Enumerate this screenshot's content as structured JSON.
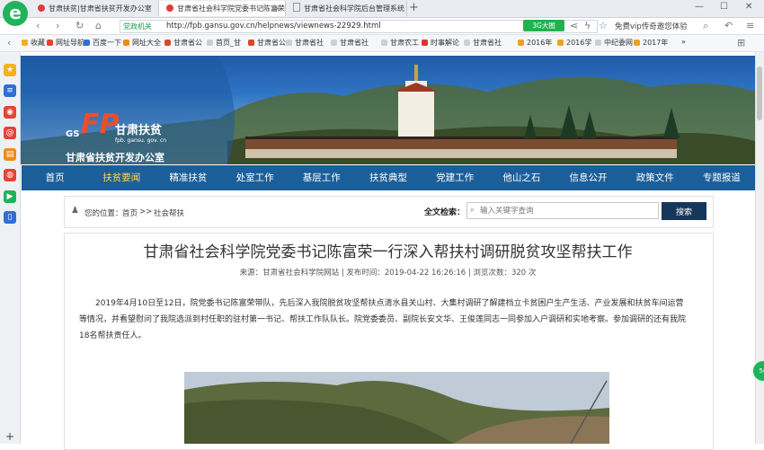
{
  "browser": {
    "logo_letter": "e",
    "tabs": [
      {
        "title": "甘肃扶贫|甘肃省扶贫开发办公室",
        "active": false
      },
      {
        "title": "甘肃省社会科学院党委书记陈富荣",
        "active": true
      },
      {
        "title": "甘肃省社会科学院后台管理系统",
        "active": false
      }
    ],
    "new_tab": "+",
    "win_controls": {
      "min": "—",
      "max": "☐",
      "close": "✕"
    },
    "address": {
      "secure_label": "党政机关",
      "url": "http://fpb.gansu.gov.cn/helpnews/viewnews-22929.html",
      "speed_label": "3G大图",
      "promo": "免费vip传奇邀您体验"
    },
    "bookmarks": [
      {
        "label": "收藏",
        "color": "#f2b01e"
      },
      {
        "label": "网址导航",
        "color": "#e54335"
      },
      {
        "label": "百度一下",
        "color": "#2f6fd6"
      },
      {
        "label": "网址大全",
        "color": "#f08a1c"
      },
      {
        "label": "甘肃省公",
        "color": "#d54b2e"
      },
      {
        "label": "首页_甘",
        "color": "#cfcfcf"
      },
      {
        "label": "甘肃省公",
        "color": "#d54b2e"
      },
      {
        "label": "甘肃省社",
        "color": "#cfcfcf"
      },
      {
        "label": "甘肃省社",
        "color": "#cfcfcf"
      },
      {
        "label": "甘肃农工",
        "color": "#cfcfcf"
      },
      {
        "label": "时事解论",
        "color": "#e53030"
      },
      {
        "label": "甘肃省社",
        "color": "#cfcfcf"
      },
      {
        "label": "2016年",
        "color": "#f0a020"
      },
      {
        "label": "2016学",
        "color": "#f0a020"
      },
      {
        "label": "中纪委网",
        "color": "#cfcfcf"
      },
      {
        "label": "2017年",
        "color": "#f0a020"
      },
      {
        "label": "»",
        "color": ""
      }
    ]
  },
  "site": {
    "logo_letters": "FP",
    "logo_gs": "GS",
    "logo_name": "甘肃扶贫",
    "logo_domain": "fpb. gansu. gov. cn",
    "office_name": "甘肃省扶贫开发办公室",
    "menu": [
      "首页",
      "扶贫要闻",
      "精准扶贫",
      "处室工作",
      "基层工作",
      "扶贫典型",
      "党建工作",
      "他山之石",
      "信息公开",
      "政策文件",
      "专题报道"
    ],
    "active_menu": 1,
    "breadcrumb": {
      "label": "您的位置：",
      "home": "首页",
      "sep": " >> ",
      "current": "社会帮扶"
    },
    "search": {
      "label": "全文检索：",
      "placeholder": "输入关键字查询",
      "button": "搜索"
    }
  },
  "article": {
    "title": "甘肃省社会科学院党委书记陈富荣一行深入帮扶村调研脱贫攻坚帮扶工作",
    "meta": "来源：甘肃省社会科学院网站 | 发布时间：2019-04-22 16:26:16 | 浏览次数：320 次",
    "body": "2019年4月10日至12日，院党委书记陈富荣带队，先后深入我院脱贫攻坚帮扶点清水县关山村、大集村调研了解建档立卡贫困户生产生活、产业发展和扶贫车间运营等情况，并看望慰问了我院选派到村任职的驻村第一书记、帮扶工作队队长。院党委委员、副院长安文华、王俊莲同志一同参加入户调研和实地考察。参加调研的还有我院18名帮扶责任人。"
  },
  "float_badge": "56"
}
